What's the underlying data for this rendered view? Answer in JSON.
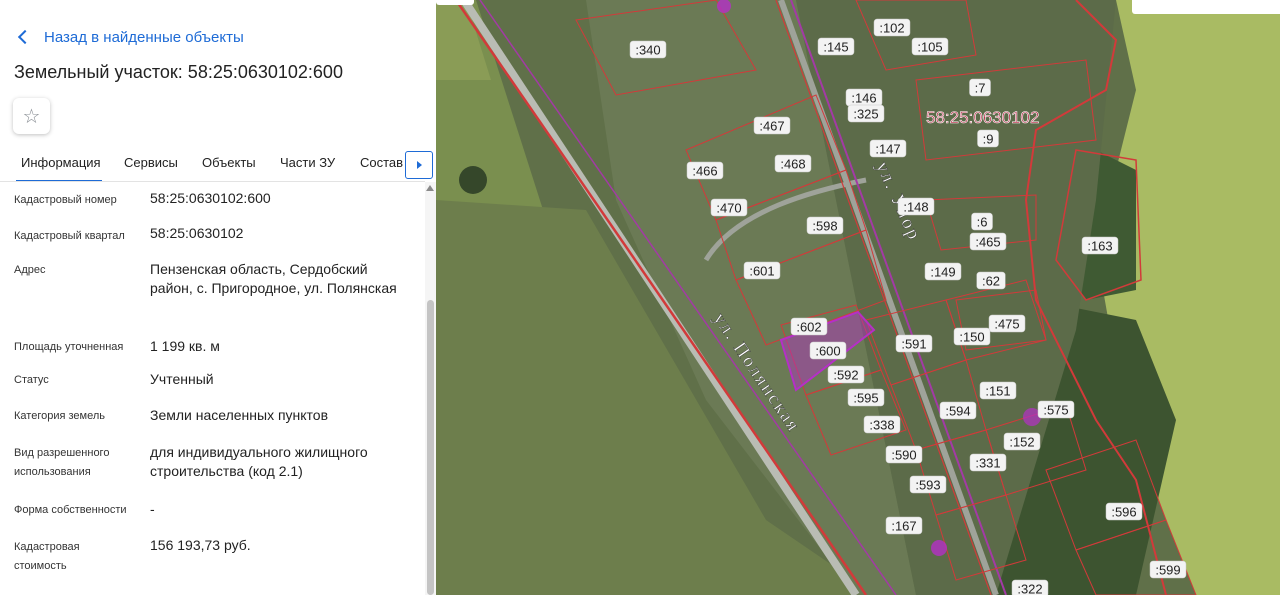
{
  "panel": {
    "back_label": "Назад в найденные объекты",
    "title": "Земельный участок: 58:25:0630102:600",
    "favorite_icon": "star-icon",
    "tabs": [
      {
        "label": "Информация",
        "active": true
      },
      {
        "label": "Сервисы",
        "active": false
      },
      {
        "label": "Объекты",
        "active": false
      },
      {
        "label": "Части ЗУ",
        "active": false
      },
      {
        "label": "Состав",
        "active": false
      }
    ],
    "properties": [
      {
        "label": "Кадастровый номер",
        "value": "58:25:0630102:600"
      },
      {
        "label": "Кадастровый квартал",
        "value": "58:25:0630102"
      },
      {
        "label": "Адрес",
        "value": "Пензенская область, Сердобский район, с. Пригородное, ул. Полянская"
      },
      {
        "label": "Площадь уточненная",
        "value": "1 199 кв. м"
      },
      {
        "label": "Статус",
        "value": "Учтенный"
      },
      {
        "label": "Категория земель",
        "value": "Земли населенных пунктов"
      },
      {
        "label": "Вид разрешенного использования",
        "value": "для индивидуального жилищного строительства (код 2.1)"
      },
      {
        "label": "Форма собственности",
        "value": "-"
      },
      {
        "label": "Кадастровая стоимость",
        "value": "156 193,73 руб."
      }
    ]
  },
  "map": {
    "quarter_label": "58:25:0630102",
    "street_1": "ул. Полянская",
    "street_2": "ул. Упор",
    "parcel_labels": [
      ":340",
      ":102",
      ":105",
      ":145",
      ":7",
      ":146",
      ":325",
      ":9",
      ":467",
      ":147",
      ":466",
      ":468",
      ":148",
      ":470",
      ":6",
      ":598",
      ":465",
      ":163",
      ":601",
      ":149",
      ":62",
      ":602",
      ":475",
      ":591",
      ":150",
      ":600",
      ":592",
      ":151",
      ":575",
      ":595",
      ":594",
      ":338",
      ":152",
      ":590",
      ":331",
      ":593",
      ":596",
      ":167",
      ":599",
      ":322"
    ],
    "colors": {
      "boundary": "#d23a3a",
      "selected": "#b52fc7",
      "label_bg": "#f3f3f3"
    }
  }
}
